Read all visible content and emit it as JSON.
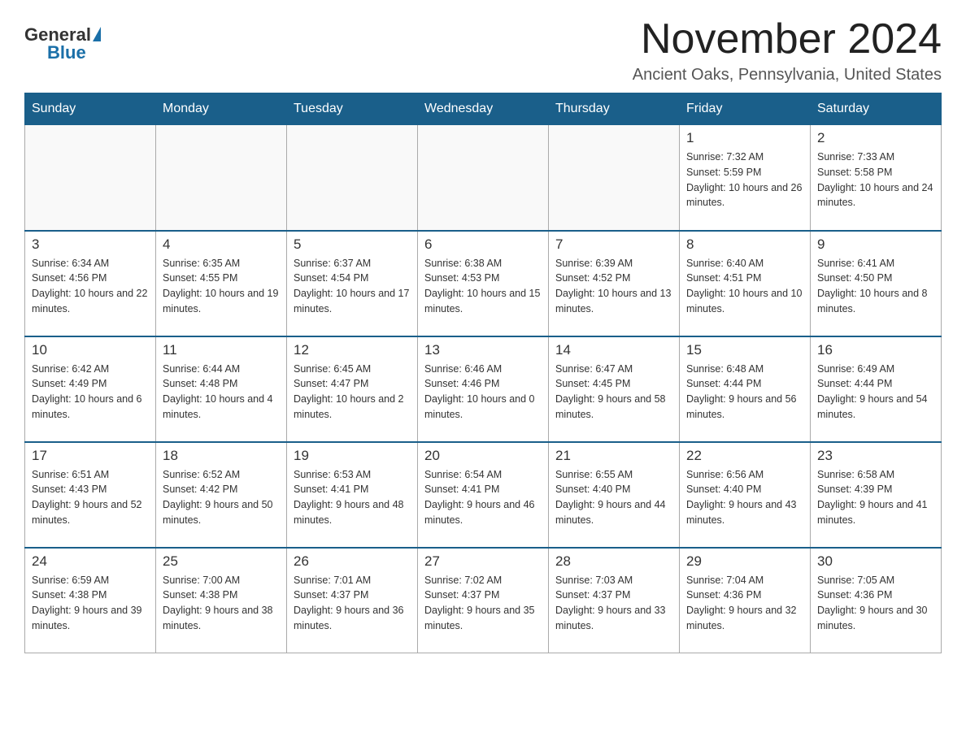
{
  "header": {
    "logo": {
      "general": "General",
      "blue": "Blue",
      "triangle": "▲"
    },
    "title": "November 2024",
    "location": "Ancient Oaks, Pennsylvania, United States"
  },
  "weekdays": [
    "Sunday",
    "Monday",
    "Tuesday",
    "Wednesday",
    "Thursday",
    "Friday",
    "Saturday"
  ],
  "weeks": [
    [
      {
        "day": "",
        "info": ""
      },
      {
        "day": "",
        "info": ""
      },
      {
        "day": "",
        "info": ""
      },
      {
        "day": "",
        "info": ""
      },
      {
        "day": "",
        "info": ""
      },
      {
        "day": "1",
        "info": "Sunrise: 7:32 AM\nSunset: 5:59 PM\nDaylight: 10 hours and 26 minutes."
      },
      {
        "day": "2",
        "info": "Sunrise: 7:33 AM\nSunset: 5:58 PM\nDaylight: 10 hours and 24 minutes."
      }
    ],
    [
      {
        "day": "3",
        "info": "Sunrise: 6:34 AM\nSunset: 4:56 PM\nDaylight: 10 hours and 22 minutes."
      },
      {
        "day": "4",
        "info": "Sunrise: 6:35 AM\nSunset: 4:55 PM\nDaylight: 10 hours and 19 minutes."
      },
      {
        "day": "5",
        "info": "Sunrise: 6:37 AM\nSunset: 4:54 PM\nDaylight: 10 hours and 17 minutes."
      },
      {
        "day": "6",
        "info": "Sunrise: 6:38 AM\nSunset: 4:53 PM\nDaylight: 10 hours and 15 minutes."
      },
      {
        "day": "7",
        "info": "Sunrise: 6:39 AM\nSunset: 4:52 PM\nDaylight: 10 hours and 13 minutes."
      },
      {
        "day": "8",
        "info": "Sunrise: 6:40 AM\nSunset: 4:51 PM\nDaylight: 10 hours and 10 minutes."
      },
      {
        "day": "9",
        "info": "Sunrise: 6:41 AM\nSunset: 4:50 PM\nDaylight: 10 hours and 8 minutes."
      }
    ],
    [
      {
        "day": "10",
        "info": "Sunrise: 6:42 AM\nSunset: 4:49 PM\nDaylight: 10 hours and 6 minutes."
      },
      {
        "day": "11",
        "info": "Sunrise: 6:44 AM\nSunset: 4:48 PM\nDaylight: 10 hours and 4 minutes."
      },
      {
        "day": "12",
        "info": "Sunrise: 6:45 AM\nSunset: 4:47 PM\nDaylight: 10 hours and 2 minutes."
      },
      {
        "day": "13",
        "info": "Sunrise: 6:46 AM\nSunset: 4:46 PM\nDaylight: 10 hours and 0 minutes."
      },
      {
        "day": "14",
        "info": "Sunrise: 6:47 AM\nSunset: 4:45 PM\nDaylight: 9 hours and 58 minutes."
      },
      {
        "day": "15",
        "info": "Sunrise: 6:48 AM\nSunset: 4:44 PM\nDaylight: 9 hours and 56 minutes."
      },
      {
        "day": "16",
        "info": "Sunrise: 6:49 AM\nSunset: 4:44 PM\nDaylight: 9 hours and 54 minutes."
      }
    ],
    [
      {
        "day": "17",
        "info": "Sunrise: 6:51 AM\nSunset: 4:43 PM\nDaylight: 9 hours and 52 minutes."
      },
      {
        "day": "18",
        "info": "Sunrise: 6:52 AM\nSunset: 4:42 PM\nDaylight: 9 hours and 50 minutes."
      },
      {
        "day": "19",
        "info": "Sunrise: 6:53 AM\nSunset: 4:41 PM\nDaylight: 9 hours and 48 minutes."
      },
      {
        "day": "20",
        "info": "Sunrise: 6:54 AM\nSunset: 4:41 PM\nDaylight: 9 hours and 46 minutes."
      },
      {
        "day": "21",
        "info": "Sunrise: 6:55 AM\nSunset: 4:40 PM\nDaylight: 9 hours and 44 minutes."
      },
      {
        "day": "22",
        "info": "Sunrise: 6:56 AM\nSunset: 4:40 PM\nDaylight: 9 hours and 43 minutes."
      },
      {
        "day": "23",
        "info": "Sunrise: 6:58 AM\nSunset: 4:39 PM\nDaylight: 9 hours and 41 minutes."
      }
    ],
    [
      {
        "day": "24",
        "info": "Sunrise: 6:59 AM\nSunset: 4:38 PM\nDaylight: 9 hours and 39 minutes."
      },
      {
        "day": "25",
        "info": "Sunrise: 7:00 AM\nSunset: 4:38 PM\nDaylight: 9 hours and 38 minutes."
      },
      {
        "day": "26",
        "info": "Sunrise: 7:01 AM\nSunset: 4:37 PM\nDaylight: 9 hours and 36 minutes."
      },
      {
        "day": "27",
        "info": "Sunrise: 7:02 AM\nSunset: 4:37 PM\nDaylight: 9 hours and 35 minutes."
      },
      {
        "day": "28",
        "info": "Sunrise: 7:03 AM\nSunset: 4:37 PM\nDaylight: 9 hours and 33 minutes."
      },
      {
        "day": "29",
        "info": "Sunrise: 7:04 AM\nSunset: 4:36 PM\nDaylight: 9 hours and 32 minutes."
      },
      {
        "day": "30",
        "info": "Sunrise: 7:05 AM\nSunset: 4:36 PM\nDaylight: 9 hours and 30 minutes."
      }
    ]
  ]
}
